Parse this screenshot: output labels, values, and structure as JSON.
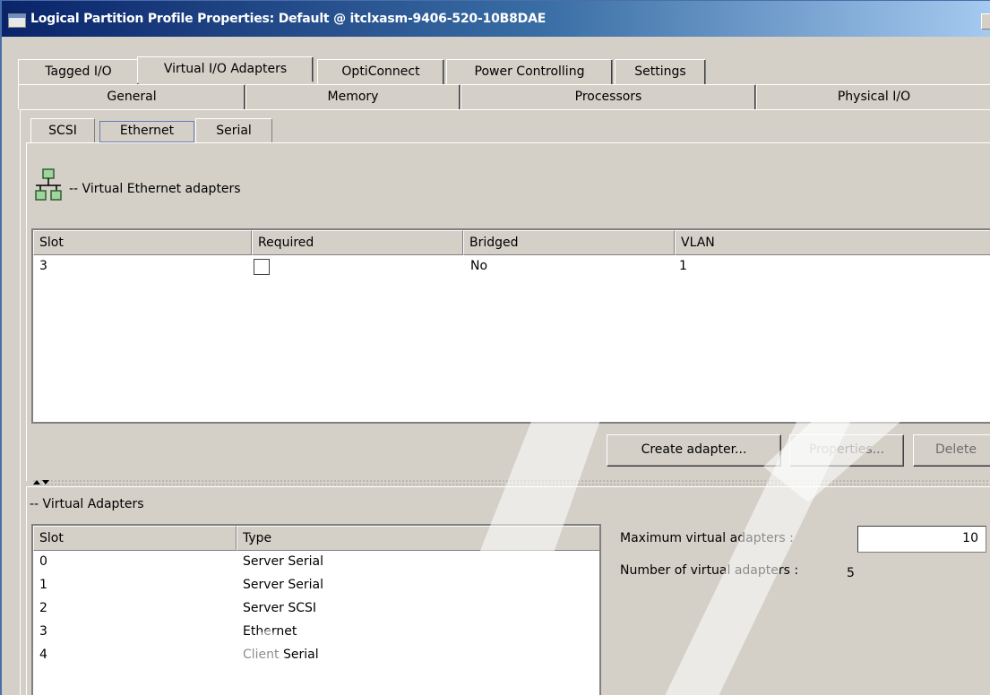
{
  "window": {
    "title": "Logical Partition Profile Properties: Default @ itclxasm-9406-520-10B8DAE"
  },
  "tabs": {
    "row1": [
      "Tagged I/O",
      "Virtual I/O Adapters",
      "OptiConnect",
      "Power Controlling",
      "Settings"
    ],
    "row2": [
      "General",
      "Memory",
      "Processors",
      "Physical I/O"
    ],
    "selected": "Virtual I/O Adapters"
  },
  "subtabs": {
    "items": [
      "SCSI",
      "Ethernet",
      "Serial"
    ],
    "selected": "Ethernet"
  },
  "ethernet": {
    "section_label": "-- Virtual Ethernet adapters",
    "columns": [
      "Slot",
      "Required",
      "Bridged",
      "VLAN"
    ],
    "rows": [
      {
        "slot": "3",
        "required": false,
        "bridged": "No",
        "vlan": "1"
      }
    ],
    "buttons": {
      "create": "Create adapter...",
      "properties": "Properties...",
      "delete": "Delete"
    }
  },
  "virtual_adapters": {
    "section_label": "-- Virtual Adapters",
    "columns": [
      "Slot",
      "Type"
    ],
    "rows": [
      {
        "slot": "0",
        "type": "Server Serial"
      },
      {
        "slot": "1",
        "type": "Server Serial"
      },
      {
        "slot": "2",
        "type": "Server SCSI"
      },
      {
        "slot": "3",
        "type": "Ethernet"
      },
      {
        "slot": "4",
        "type": "Client Serial"
      }
    ],
    "max_label": "Maximum virtual adapters :",
    "max_value": "10",
    "count_label": "Number of virtual adapters :",
    "count_value": "5"
  },
  "icons": {
    "network": "network-icon",
    "window": "window-icon"
  },
  "colors": {
    "titlebar_start": "#0a246a",
    "titlebar_end": "#a6caf0",
    "panel": "#d4d0c8"
  }
}
